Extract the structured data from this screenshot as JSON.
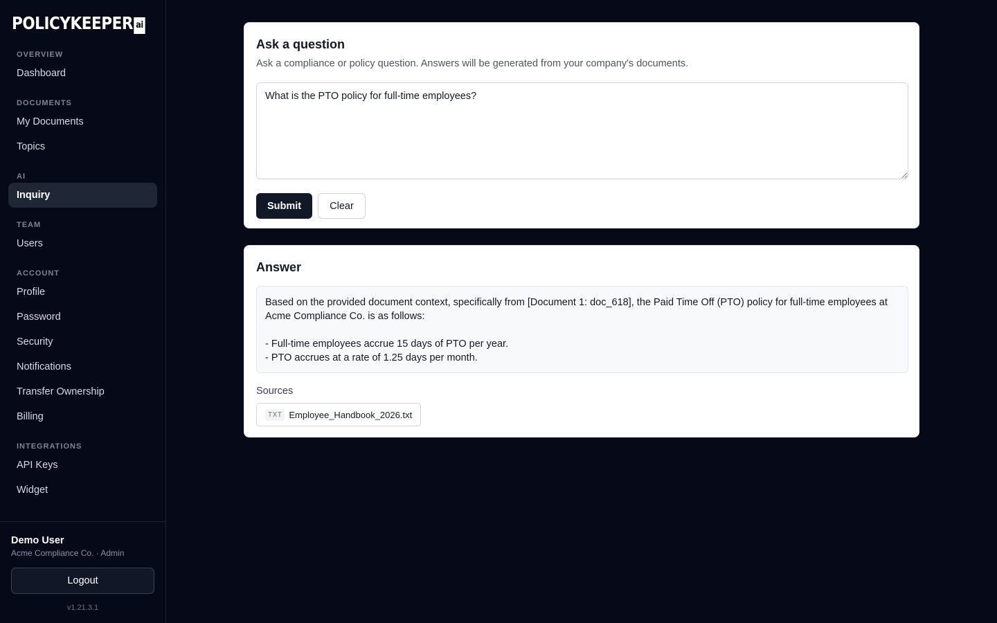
{
  "brand": {
    "name": "POLICYKEEPER",
    "badge": "ai"
  },
  "sidebar": {
    "sections": [
      {
        "heading": "OVERVIEW",
        "items": [
          "Dashboard"
        ]
      },
      {
        "heading": "DOCUMENTS",
        "items": [
          "My Documents",
          "Topics"
        ]
      },
      {
        "heading": "AI",
        "items": [
          "Inquiry"
        ]
      },
      {
        "heading": "TEAM",
        "items": [
          "Users"
        ]
      },
      {
        "heading": "ACCOUNT",
        "items": [
          "Profile",
          "Password",
          "Security",
          "Notifications",
          "Transfer Ownership",
          "Billing"
        ]
      },
      {
        "heading": "INTEGRATIONS",
        "items": [
          "API Keys",
          "Widget"
        ]
      }
    ],
    "active_item": "Inquiry",
    "user": {
      "name": "Demo User",
      "org": "Acme Compliance Co. · Admin"
    },
    "logout_label": "Logout",
    "version": "v1.21.3.1"
  },
  "ask": {
    "title": "Ask a question",
    "description": "Ask a compliance or policy question. Answers will be generated from your company's documents.",
    "question": "What is the PTO policy for full-time employees?",
    "submit_label": "Submit",
    "clear_label": "Clear"
  },
  "answer": {
    "title": "Answer",
    "lines": [
      "Based on the provided document context, specifically from [Document 1: doc_618], the Paid Time Off (PTO) policy for full-time employees at Acme Compliance Co. is as follows:",
      "",
      "- Full-time employees accrue 15 days of PTO per year.",
      "- PTO accrues at a rate of 1.25 days per month."
    ],
    "sources_label": "Sources",
    "sources": [
      {
        "type": "TXT",
        "name": "Employee_Handbook_2026.txt"
      }
    ]
  },
  "colors": {
    "background": "#060a18",
    "active_nav": "#1f2736",
    "primary_button": "#111827"
  }
}
